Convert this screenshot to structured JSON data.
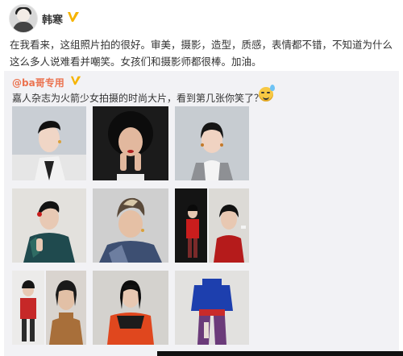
{
  "post": {
    "author": "韩寒",
    "text": "在我看来，这组照片拍的很好。审美，摄影，造型，质感，表情都不错，不知道为什么这么多人说难看并嘲笑。女孩们和摄影师都很棒。加油。"
  },
  "repost": {
    "author": "@ba哥专用",
    "text": "嘉人杂志为火箭少女拍摄的时尚大片，看到第几张你笑了？"
  },
  "icons": {
    "verified": "verified-v-badge",
    "emoji": "sweat-smile-emoji"
  },
  "colors": {
    "repost_author": "#eb7350",
    "verified_badge": "#f6b400",
    "repost_background": "#f2f2f5"
  }
}
